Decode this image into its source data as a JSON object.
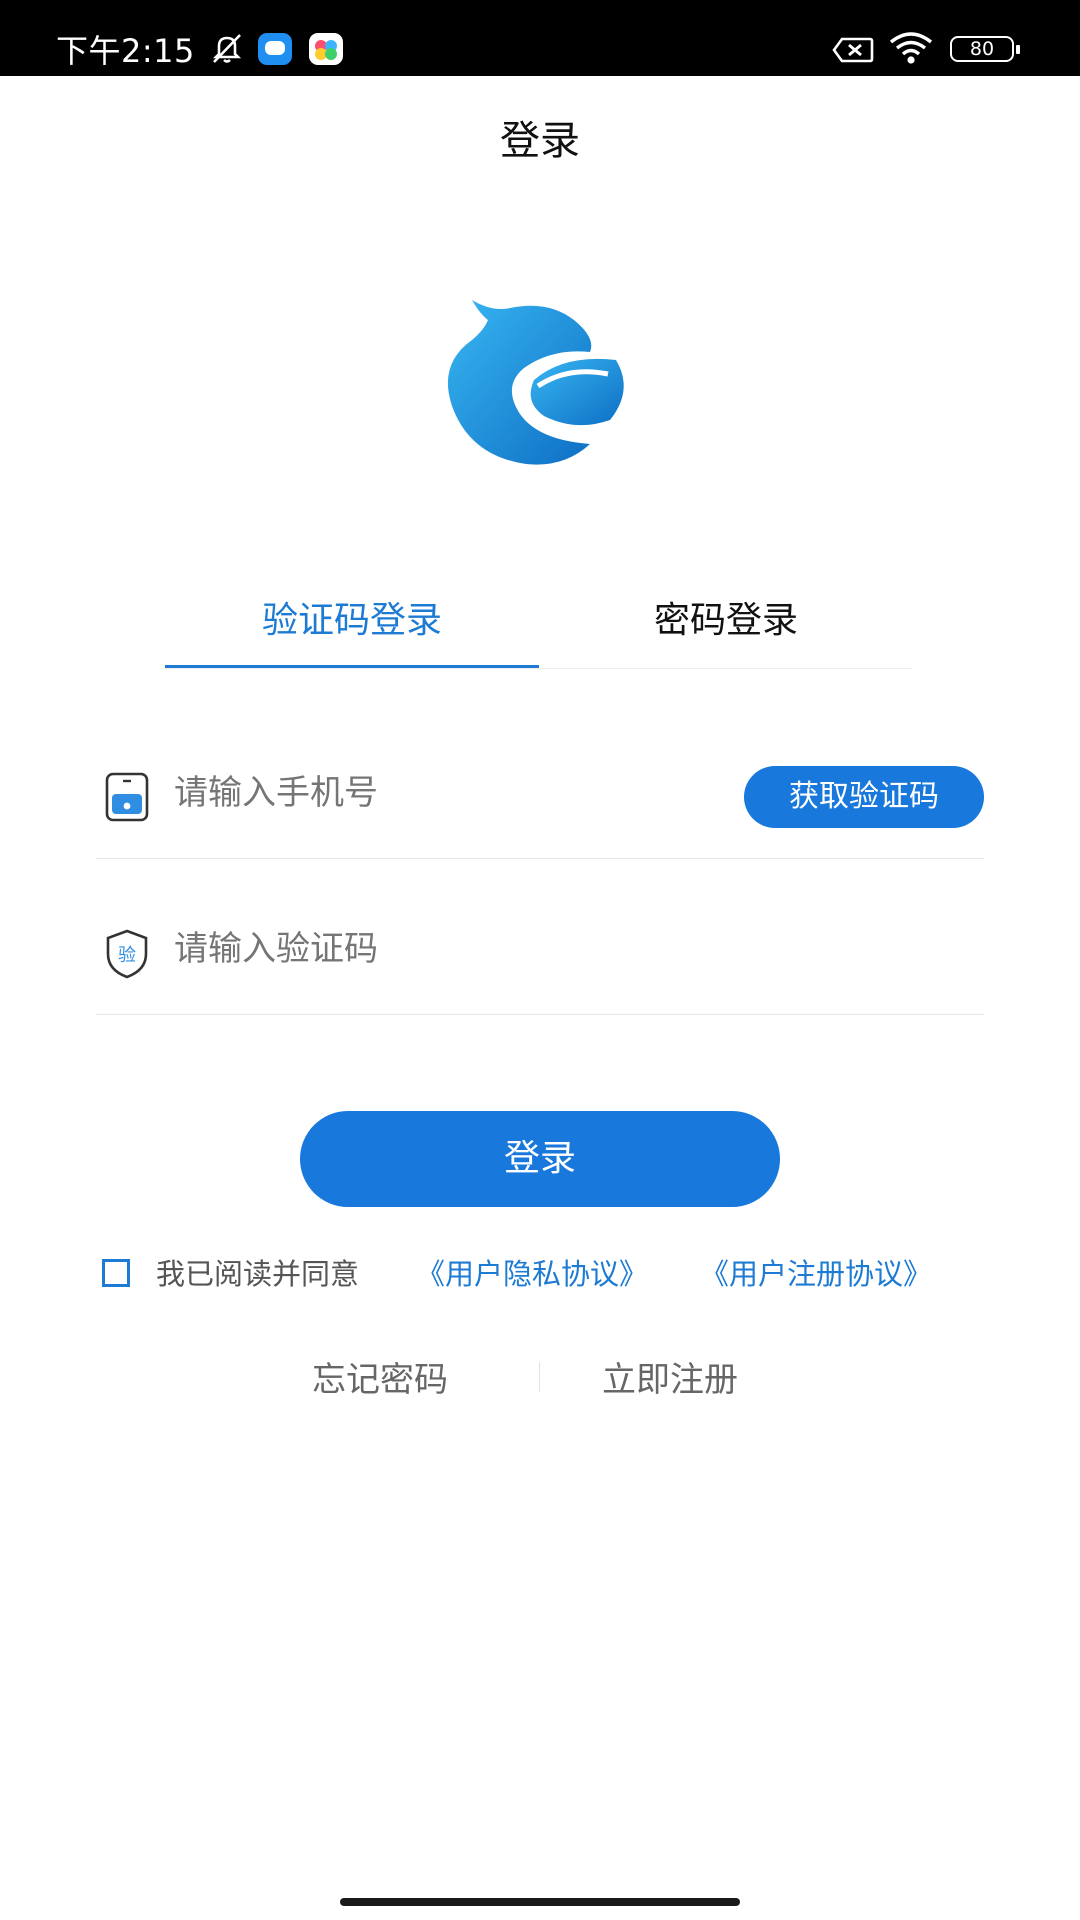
{
  "status_bar": {
    "time": "下午2:15",
    "battery": "80",
    "icons": [
      "notifications-muted-icon",
      "messenger-app-icon",
      "colorful-app-icon",
      "no-sim-icon",
      "wifi-icon",
      "battery-icon"
    ]
  },
  "header": {
    "title": "登录"
  },
  "logo": {
    "name": "app-logo-icon",
    "color": "#1a8ee0"
  },
  "tabs": [
    {
      "label": "验证码登录",
      "active": true
    },
    {
      "label": "密码登录",
      "active": false
    }
  ],
  "form": {
    "phone": {
      "value": "",
      "placeholder": "请输入手机号",
      "icon": "phone-icon"
    },
    "code": {
      "value": "",
      "placeholder": "请输入验证码",
      "icon": "shield-verify-icon",
      "icon_glyph": "验"
    },
    "get_code_label": "获取验证码",
    "login_label": "登录"
  },
  "agreement": {
    "checked": false,
    "text": "我已阅读并同意",
    "privacy_link": "《用户隐私协议》",
    "register_link": "《用户注册协议》"
  },
  "links": {
    "forgot_password": "忘记密码",
    "register_now": "立即注册"
  },
  "colors": {
    "accent": "#1878dc",
    "tab_active": "#1e7bd4",
    "status_bar": "#000000"
  }
}
